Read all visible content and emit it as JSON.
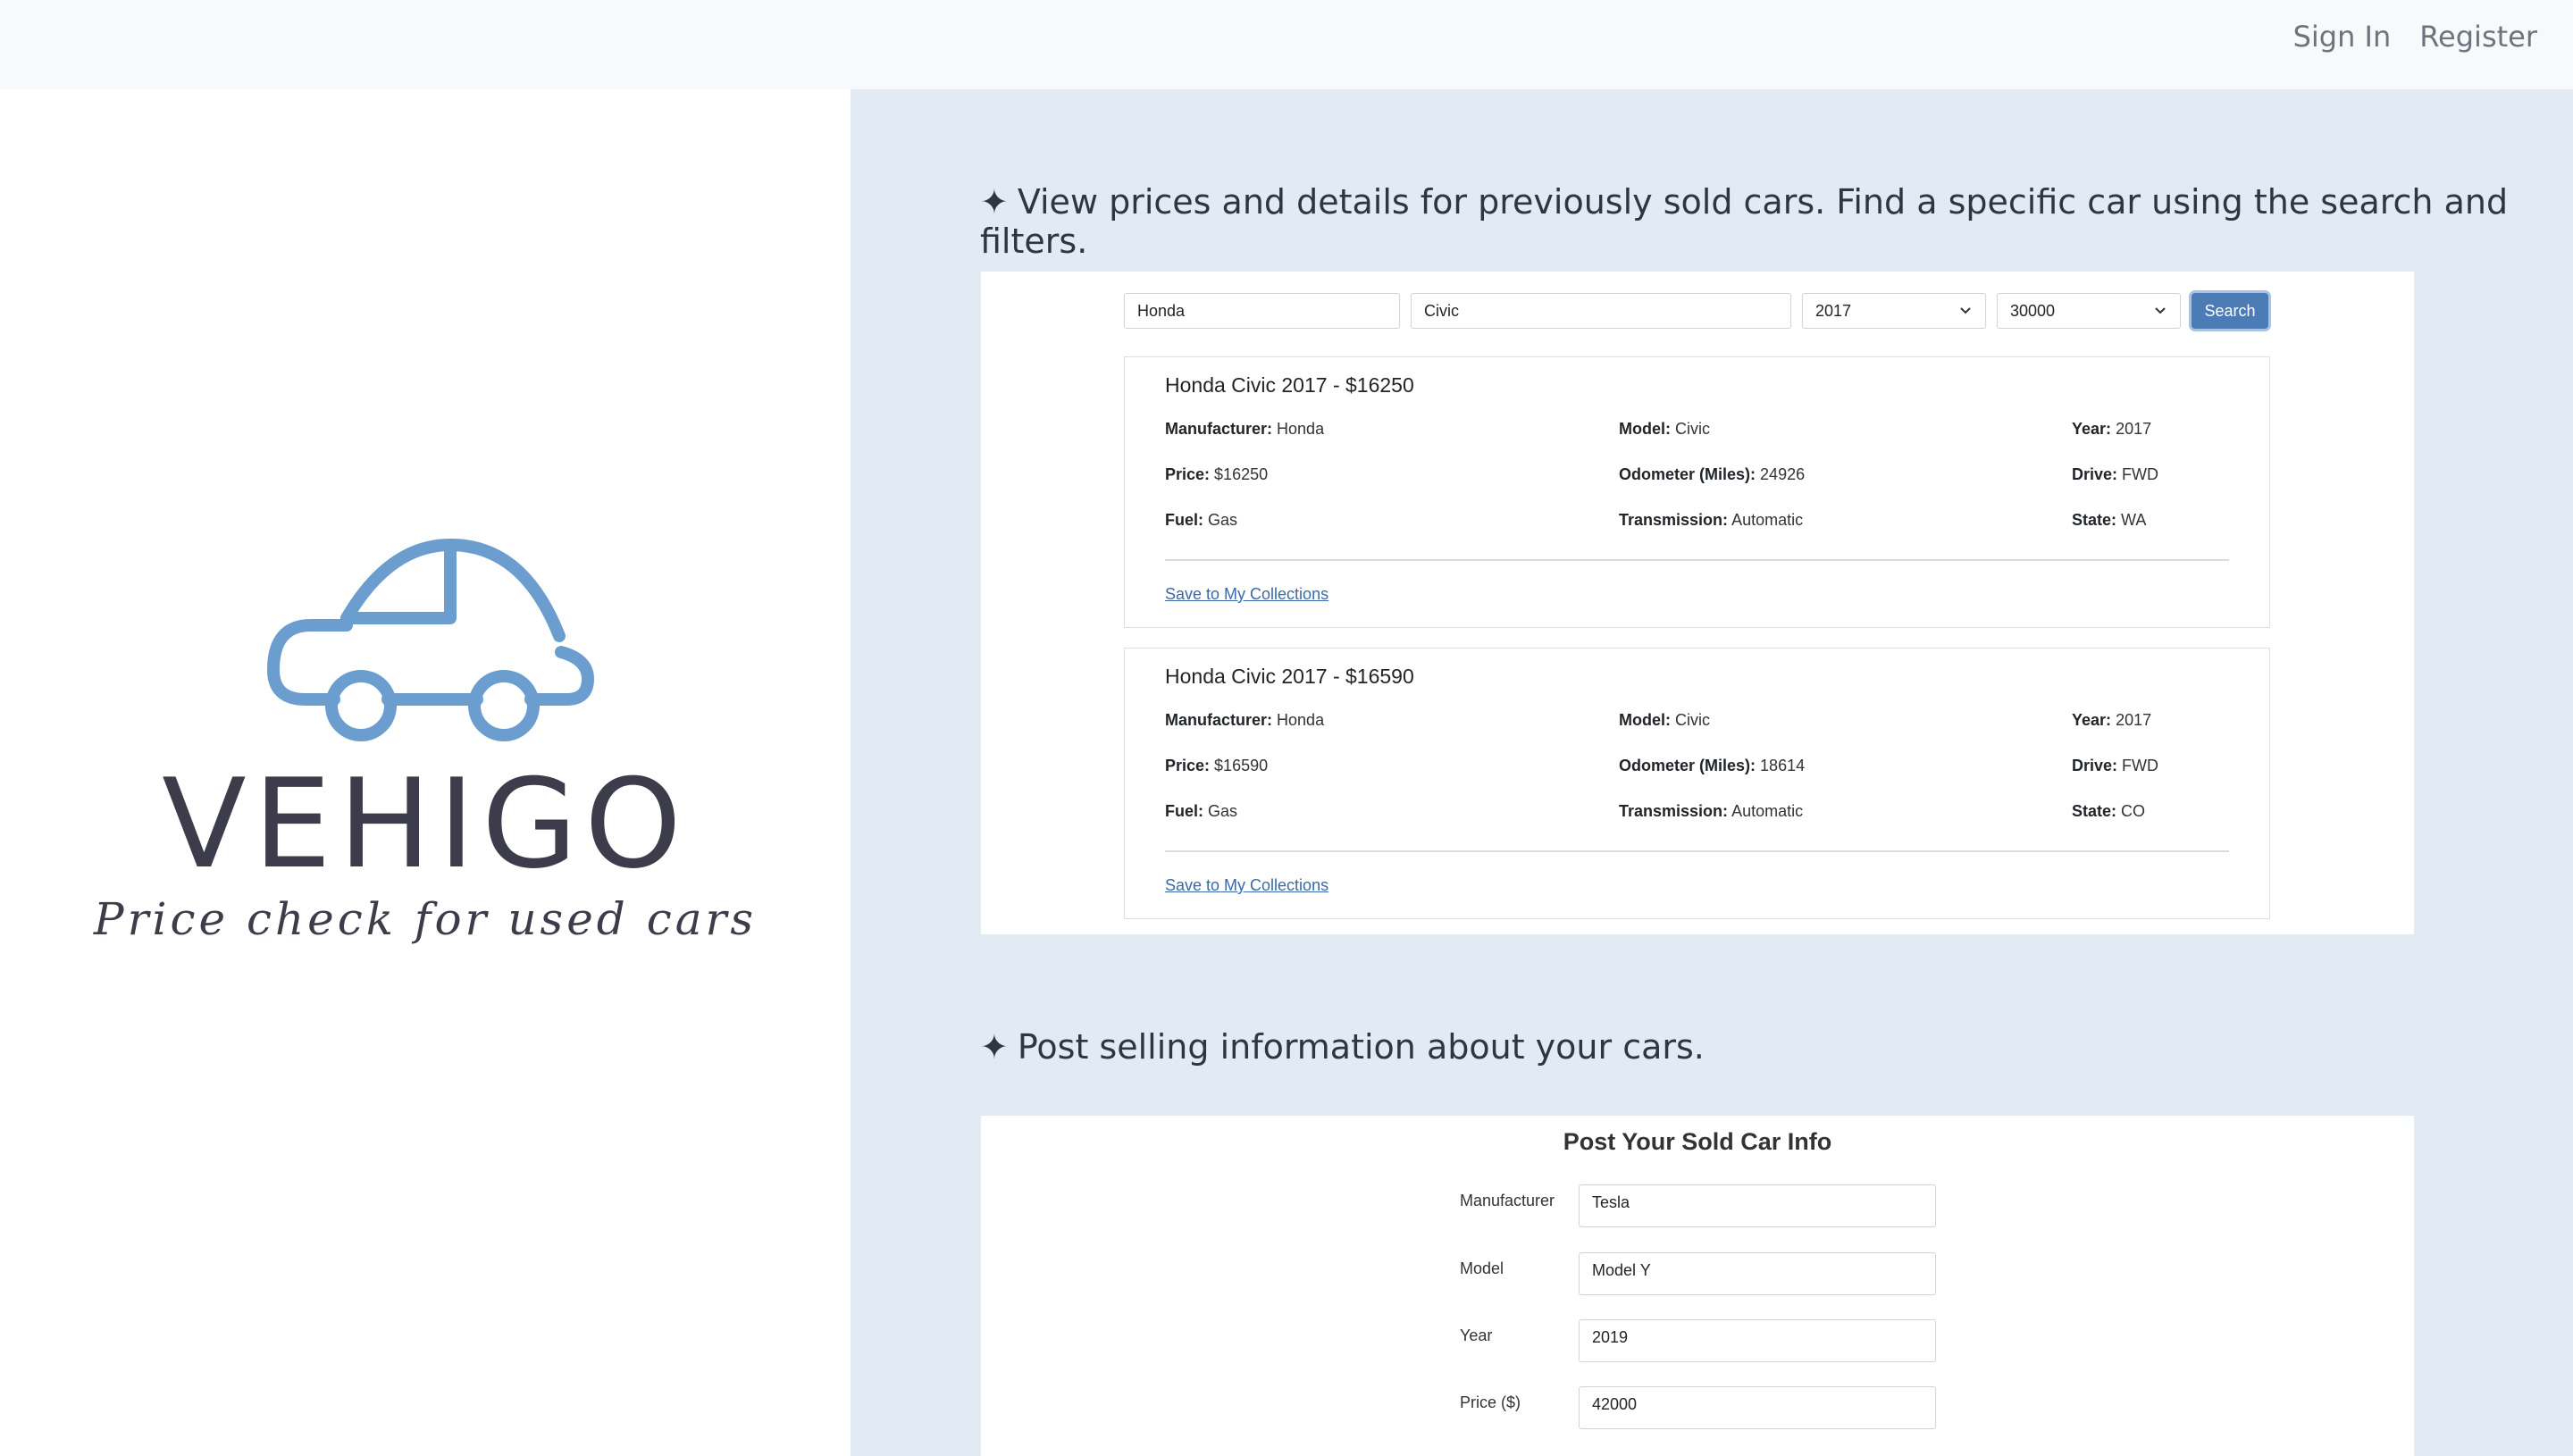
{
  "nav": {
    "sign_in": "Sign In",
    "register": "Register"
  },
  "brand": {
    "name": "VEHIGO",
    "tagline": "Price check for used cars",
    "logo_color": "#6b9ecf"
  },
  "sections": {
    "view_title": "View prices and details for previously sold cars. Find a specific car using the search and filters.",
    "post_title": "Post selling information about your cars.",
    "star": "✦"
  },
  "search": {
    "manufacturer": "Honda",
    "model": "Civic",
    "year": "2017",
    "mileage": "30000",
    "button": "Search"
  },
  "labels": {
    "manufacturer": "Manufacturer:",
    "model": "Model:",
    "year": "Year:",
    "price": "Price:",
    "odometer": "Odometer (Miles):",
    "drive": "Drive:",
    "fuel": "Fuel:",
    "transmission": "Transmission:",
    "state": "State:",
    "save": "Save to My Collections"
  },
  "results": [
    {
      "title": "Honda Civic 2017 - $16250",
      "manufacturer": "Honda",
      "model": "Civic",
      "year": "2017",
      "price": "$16250",
      "odometer": "24926",
      "drive": "FWD",
      "fuel": "Gas",
      "transmission": "Automatic",
      "state": "WA"
    },
    {
      "title": "Honda Civic 2017 - $16590",
      "manufacturer": "Honda",
      "model": "Civic",
      "year": "2017",
      "price": "$16590",
      "odometer": "18614",
      "drive": "FWD",
      "fuel": "Gas",
      "transmission": "Automatic",
      "state": "CO"
    }
  ],
  "post_form": {
    "title": "Post Your Sold Car Info",
    "fields": [
      {
        "label": "Manufacturer",
        "value": "Tesla"
      },
      {
        "label": "Model",
        "value": "Model Y"
      },
      {
        "label": "Year",
        "value": "2019"
      },
      {
        "label": "Price ($)",
        "value": "42000"
      }
    ]
  }
}
